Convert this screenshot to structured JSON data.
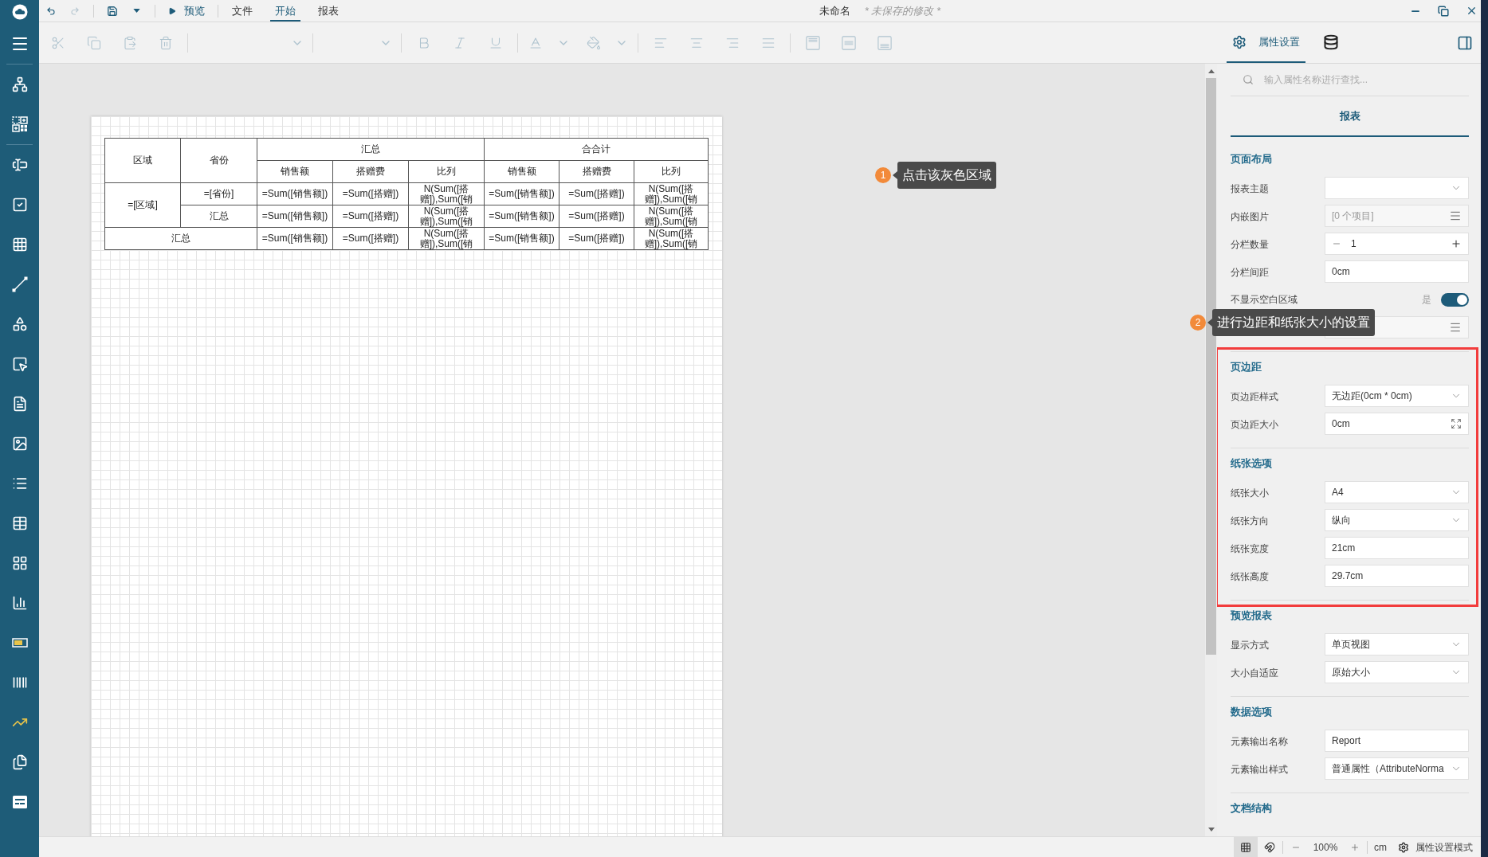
{
  "window": {
    "title": "未命名",
    "unsaved_note": "* 未保存的修改 *"
  },
  "quick_access": [
    {
      "kind": "undo",
      "disabled": false
    },
    {
      "kind": "redo",
      "disabled": true
    },
    {
      "kind": "separator"
    },
    {
      "kind": "save",
      "disabled": false
    },
    {
      "kind": "save_menu",
      "disabled": false
    },
    {
      "kind": "separator"
    }
  ],
  "preview_button": {
    "label": "预览"
  },
  "menu_tabs": [
    {
      "label": "文件",
      "selected": false
    },
    {
      "label": "开始",
      "selected": true
    },
    {
      "label": "报表",
      "selected": false
    }
  ],
  "toolbar": [
    {
      "kind": "cut",
      "disabled": true
    },
    {
      "kind": "copy",
      "disabled": true
    },
    {
      "kind": "paste",
      "disabled": true
    },
    {
      "kind": "delete",
      "disabled": true
    },
    {
      "kind": "separator"
    },
    {
      "kind": "font_family",
      "disabled": true
    },
    {
      "kind": "separator"
    },
    {
      "kind": "font_size",
      "disabled": true
    },
    {
      "kind": "separator"
    },
    {
      "kind": "bold",
      "disabled": true
    },
    {
      "kind": "italic",
      "disabled": true
    },
    {
      "kind": "underline",
      "disabled": true
    },
    {
      "kind": "separator"
    },
    {
      "kind": "font_color",
      "disabled": true
    },
    {
      "kind": "font_color_menu",
      "disabled": true
    },
    {
      "kind": "fill_color",
      "disabled": true
    },
    {
      "kind": "fill_color_menu",
      "disabled": true
    },
    {
      "kind": "separator"
    },
    {
      "kind": "align_left",
      "disabled": true
    },
    {
      "kind": "align_center",
      "disabled": true
    },
    {
      "kind": "align_right",
      "disabled": true
    },
    {
      "kind": "justify",
      "disabled": true
    },
    {
      "kind": "separator"
    },
    {
      "kind": "layout_top",
      "disabled": true
    },
    {
      "kind": "layout_middle",
      "disabled": true
    },
    {
      "kind": "layout_bottom",
      "disabled": true
    }
  ],
  "panel_tabs": [
    {
      "kind": "properties",
      "label": "属性设置",
      "selected": true
    },
    {
      "kind": "data",
      "selected": false
    }
  ],
  "panel": {
    "search": {
      "placeholder": "输入属性名称进行查找..."
    },
    "subtabs": [
      {
        "label": "报表",
        "selected": true
      }
    ],
    "sections": [
      {
        "title": "页面布局",
        "rows": [
          {
            "kind": "select",
            "label": "报表主题"
          },
          {
            "kind": "list",
            "label": "内嵌图片",
            "value": "[0 个项目]"
          },
          {
            "kind": "stepper",
            "label": "分栏数量",
            "value": "1"
          },
          {
            "kind": "text",
            "label": "分栏间距",
            "value": "0cm"
          },
          {
            "kind": "toggle",
            "label": "不显示空白区域",
            "value": "是",
            "on": true
          },
          {
            "kind": "list"
          }
        ]
      },
      {
        "title": "页边距",
        "highlighted": true,
        "rows": [
          {
            "kind": "select",
            "label": "页边距样式",
            "value": "无边距(0cm * 0cm)"
          },
          {
            "kind": "size",
            "label": "页边距大小",
            "value": "0cm"
          }
        ]
      },
      {
        "title": "纸张选项",
        "highlighted": true,
        "rows": [
          {
            "kind": "select",
            "label": "纸张大小",
            "value": "A4"
          },
          {
            "kind": "select",
            "label": "纸张方向",
            "value": "纵向"
          },
          {
            "kind": "text",
            "label": "纸张宽度",
            "value": "21cm"
          },
          {
            "kind": "text",
            "label": "纸张高度",
            "value": "29.7cm"
          }
        ]
      },
      {
        "title": "预览报表",
        "rows": [
          {
            "kind": "select",
            "label": "显示方式",
            "value": "单页视图"
          },
          {
            "kind": "select",
            "label": "大小自适应",
            "value": "原始大小"
          }
        ]
      },
      {
        "title": "数据选项",
        "rows": [
          {
            "kind": "text",
            "label": "元素输出名称",
            "value": "Report"
          },
          {
            "kind": "select",
            "label": "元素输出样式",
            "value": "普通属性（AttributeNorma"
          }
        ]
      },
      {
        "title": "文档结构"
      }
    ]
  },
  "report_table": {
    "rows": [
      [
        {
          "text": "区域",
          "rowspan": 2
        },
        {
          "text": "省份",
          "rowspan": 2
        },
        {
          "text": "汇总",
          "colspan": 3
        },
        {
          "text": "合合计",
          "colspan": 3
        }
      ],
      [
        {
          "text": "销售额"
        },
        {
          "text": "搭赠费"
        },
        {
          "text": "比列"
        },
        {
          "text": "销售额"
        },
        {
          "text": "搭赠费"
        },
        {
          "text": "比列"
        }
      ],
      [
        {
          "text": "=[区域]",
          "rowspan": 2
        },
        {
          "text": "=[省份]"
        },
        {
          "text": "=Sum([销售额])"
        },
        {
          "text": "=Sum([搭赠])"
        },
        {
          "text": "N(Sum([搭赠]),Sum([销"
        },
        {
          "text": "=Sum([销售额])"
        },
        {
          "text": "=Sum([搭赠])"
        },
        {
          "text": "N(Sum([搭赠]),Sum([销"
        }
      ],
      [
        {
          "text": "汇总"
        },
        {
          "text": "=Sum([销售额])"
        },
        {
          "text": "=Sum([搭赠])"
        },
        {
          "text": "N(Sum([搭赠]),Sum([销"
        },
        {
          "text": "=Sum([销售额])"
        },
        {
          "text": "=Sum([搭赠])"
        },
        {
          "text": "N(Sum([搭赠]),Sum([销"
        }
      ],
      [
        {
          "text": "汇总",
          "colspan": 2
        },
        {
          "text": "=Sum([销售额])"
        },
        {
          "text": "=Sum([搭赠])"
        },
        {
          "text": "N(Sum([搭赠]),Sum([销"
        },
        {
          "text": "=Sum([销售额])"
        },
        {
          "text": "=Sum([搭赠])"
        },
        {
          "text": "N(Sum([搭赠]),Sum([销"
        }
      ]
    ]
  },
  "callouts": [
    {
      "number": "1",
      "text": "点击该灰色区域"
    },
    {
      "number": "2",
      "text": "进行边距和纸张大小的设置"
    }
  ],
  "status_bar": {
    "toggles": [
      {
        "kind": "grid",
        "selected": true
      },
      {
        "kind": "snap",
        "selected": false
      }
    ],
    "zoom": "100%",
    "unit": "cm",
    "mode": "属性设置模式"
  }
}
